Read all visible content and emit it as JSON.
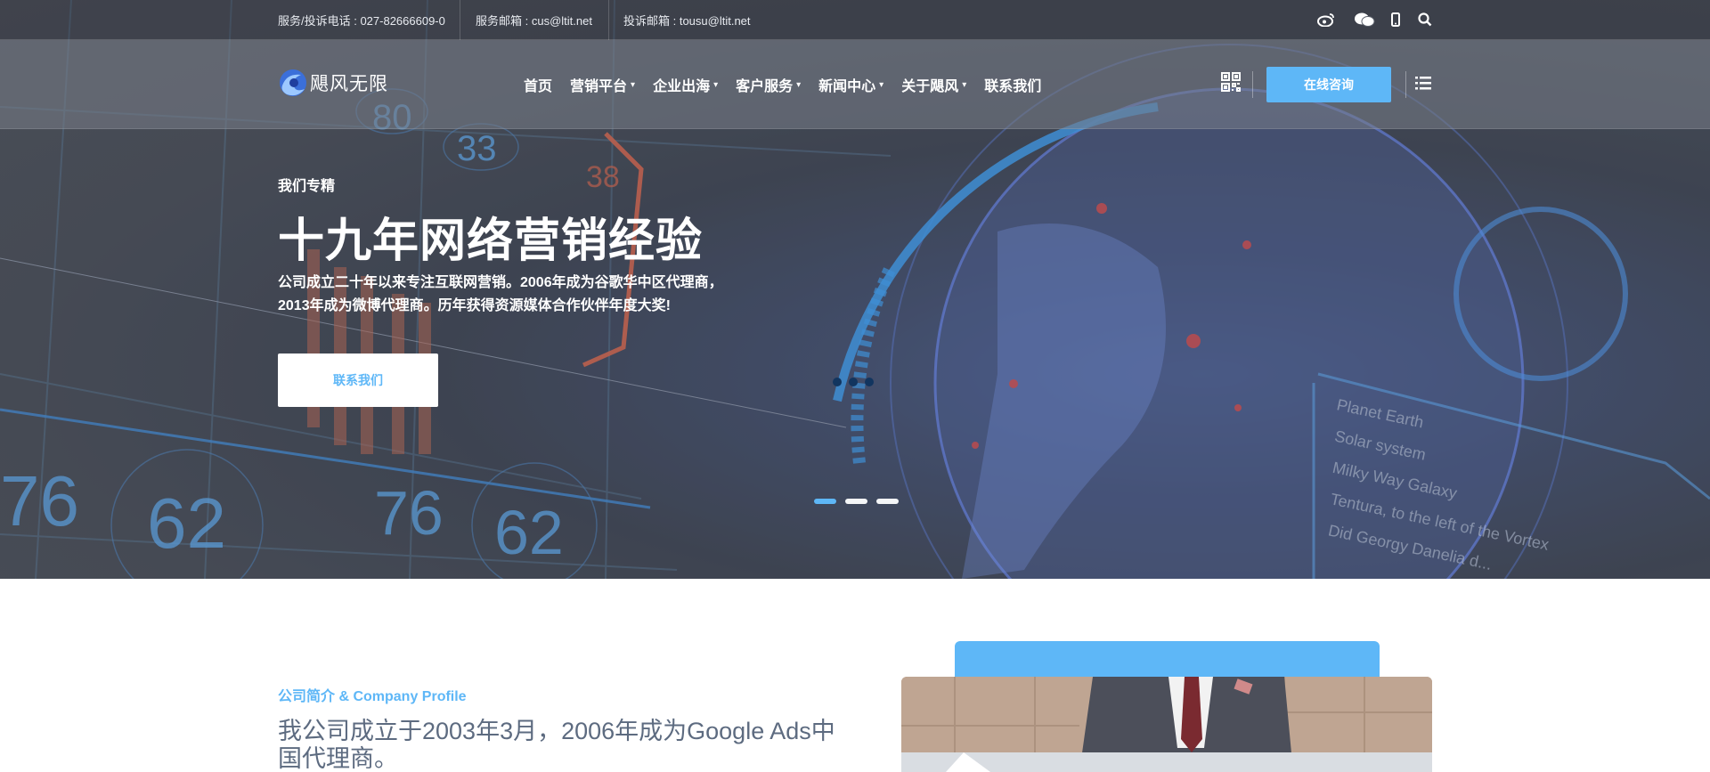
{
  "topbar": {
    "phone": "服务/投诉电话 : 027-82666609-0",
    "service_email": "服务邮箱 : cus@ltit.net",
    "complaint_email": "投诉邮箱 : tousu@ltit.net",
    "icons": [
      "weibo-icon",
      "wechat-icon",
      "mobile-icon",
      "search-icon"
    ]
  },
  "header": {
    "logo_text": "飓风无限",
    "nav": [
      {
        "label": "首页",
        "dropdown": false
      },
      {
        "label": "营销平台",
        "dropdown": true
      },
      {
        "label": "企业出海",
        "dropdown": true
      },
      {
        "label": "客户服务",
        "dropdown": true
      },
      {
        "label": "新闻中心",
        "dropdown": true
      },
      {
        "label": "关于飓风",
        "dropdown": true
      },
      {
        "label": "联系我们",
        "dropdown": false
      }
    ],
    "consult_label": "在线咨询",
    "icons": [
      "qr-code-icon",
      "menu-list-icon"
    ]
  },
  "hero": {
    "kicker": "我们专精",
    "headline": "十九年网络营销经验",
    "description": "公司成立二十年以来专注互联网营销。2006年成为谷歌华中区代理商，2013年成为微博代理商。历年获得资源媒体合作伙伴年度大奖!",
    "button_label": "联系我们",
    "slides": 3,
    "active_slide": 1,
    "background_numbers": [
      "80",
      "33",
      "38",
      "76",
      "62",
      "76",
      "62"
    ],
    "background_list": [
      "Planet Earth",
      "Solar system",
      "Milky Way Galaxy",
      "Tentura, to the left of the Vortex",
      "Did Georgy Danelia d..."
    ]
  },
  "profile": {
    "label": "公司简介 & Company Profile",
    "title": "我公司成立于2003年3月，2006年成为Google Ads中国代理商。"
  },
  "colors": {
    "accent": "#5eb7f7",
    "nav_bg": "#7b8290",
    "hero_dark": "#3f4452",
    "title_gray": "#5d6b80"
  }
}
